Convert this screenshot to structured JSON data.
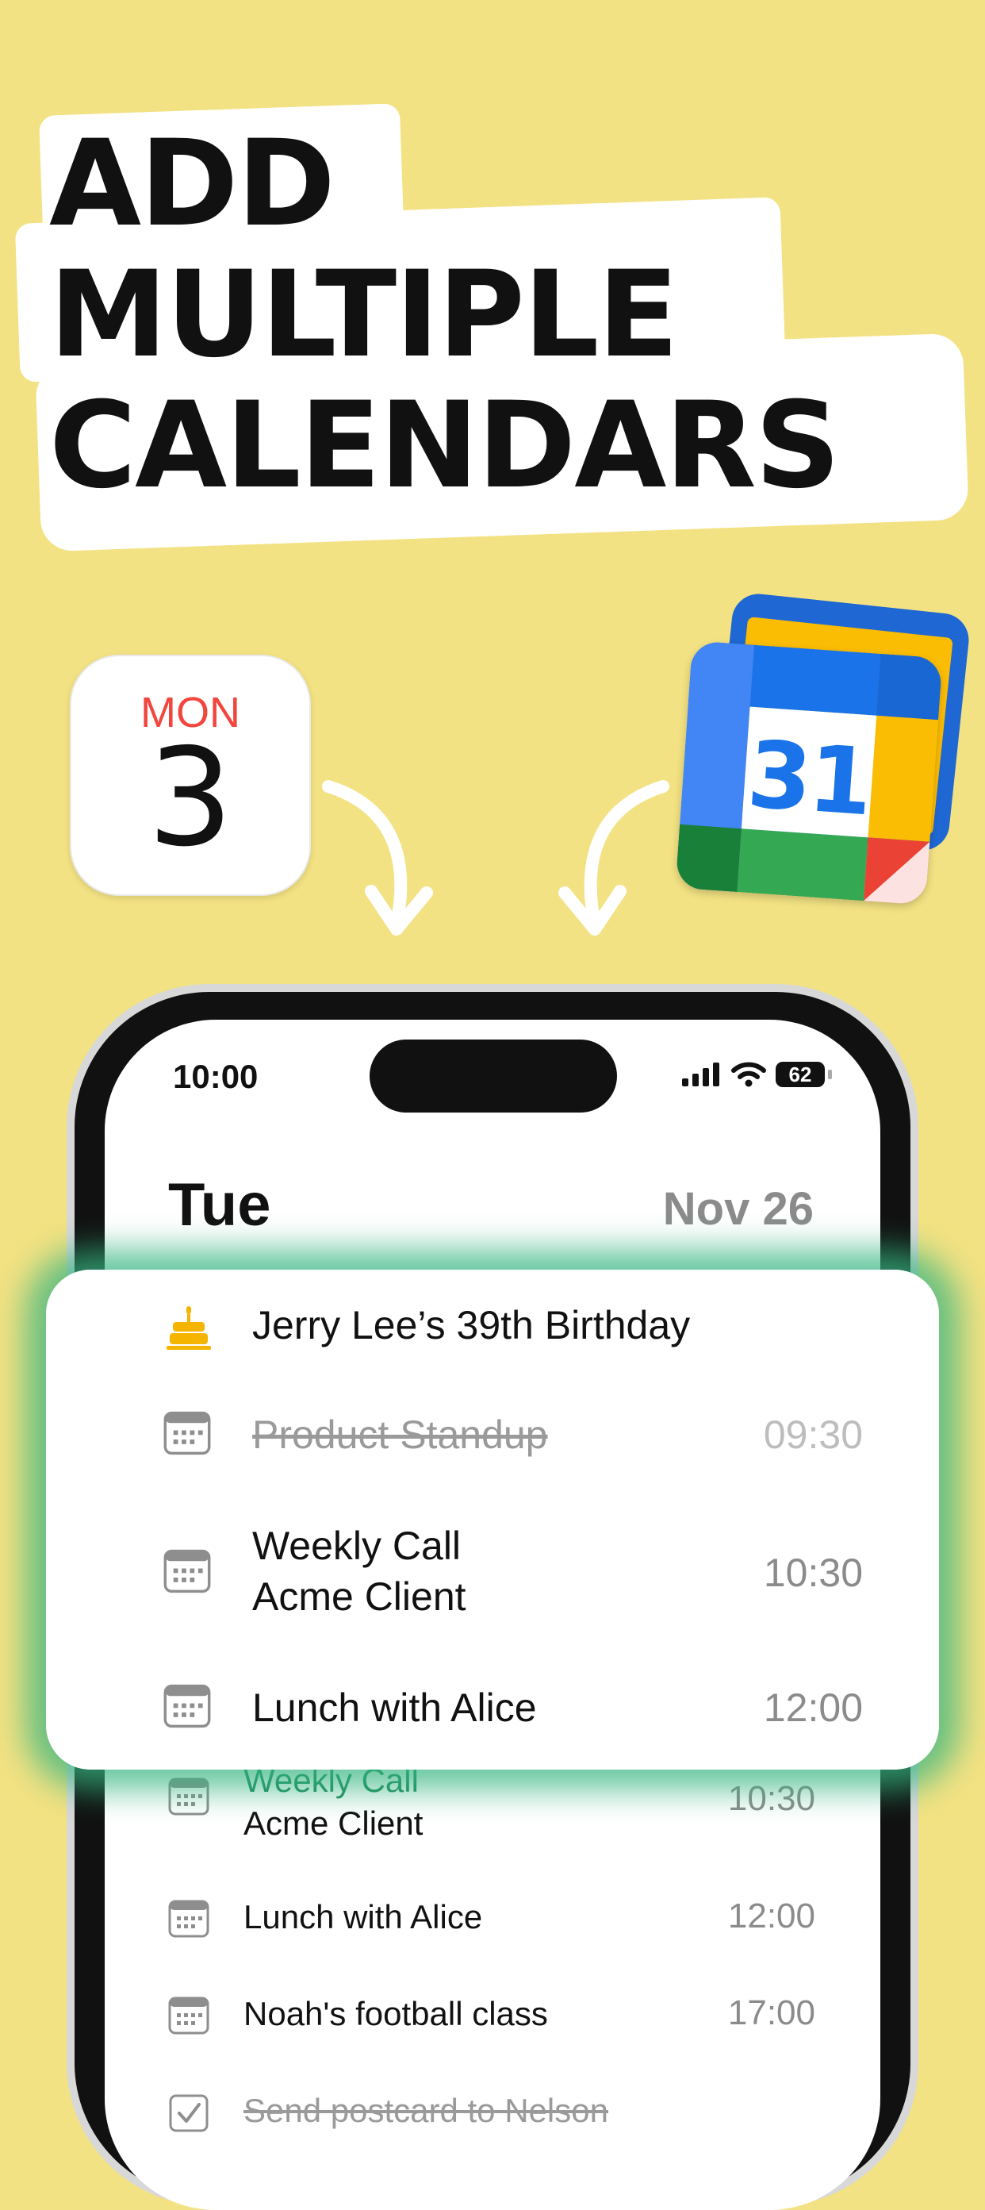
{
  "headline": {
    "lines": [
      "ADD",
      "MULTIPLE",
      "CALENDARS"
    ]
  },
  "apple_calendar_icon": {
    "weekday": "MON",
    "day": "3"
  },
  "google_calendar_icon": {
    "day": "31"
  },
  "status_bar": {
    "time": "10:00",
    "battery": "62"
  },
  "header": {
    "day": "Tue",
    "date": "Nov 26"
  },
  "focus_list": [
    {
      "title": "Jerry Lee’s 39th Birthday",
      "time": "",
      "icon": "birthday-cake-icon",
      "completed": false
    },
    {
      "title": "Product Standup",
      "time": "09:30",
      "icon": "calendar-icon",
      "completed": true
    },
    {
      "title": "Weekly Call\nAcme Client",
      "line1": "Weekly Call",
      "line2": "Acme Client",
      "time": "10:30",
      "icon": "calendar-icon",
      "completed": false
    },
    {
      "title": "Lunch with Alice",
      "time": "12:00",
      "icon": "calendar-icon",
      "completed": false
    }
  ],
  "background_list": [
    {
      "line1": "Weekly Call",
      "line2": "Acme Client",
      "time": "10:30",
      "icon": "calendar-icon"
    },
    {
      "title": "Lunch with Alice",
      "time": "12:00",
      "icon": "calendar-icon"
    },
    {
      "title": "Noah's football class",
      "time": "17:00",
      "icon": "calendar-icon"
    },
    {
      "title": "Send postcard to Nelson",
      "time": "",
      "icon": "checkbox-icon",
      "completed": true
    }
  ],
  "colors": {
    "background": "#f3e283",
    "highlight_glow": "#36b480",
    "apple_red": "#f2453d",
    "google_blue": "#1a73e8"
  }
}
